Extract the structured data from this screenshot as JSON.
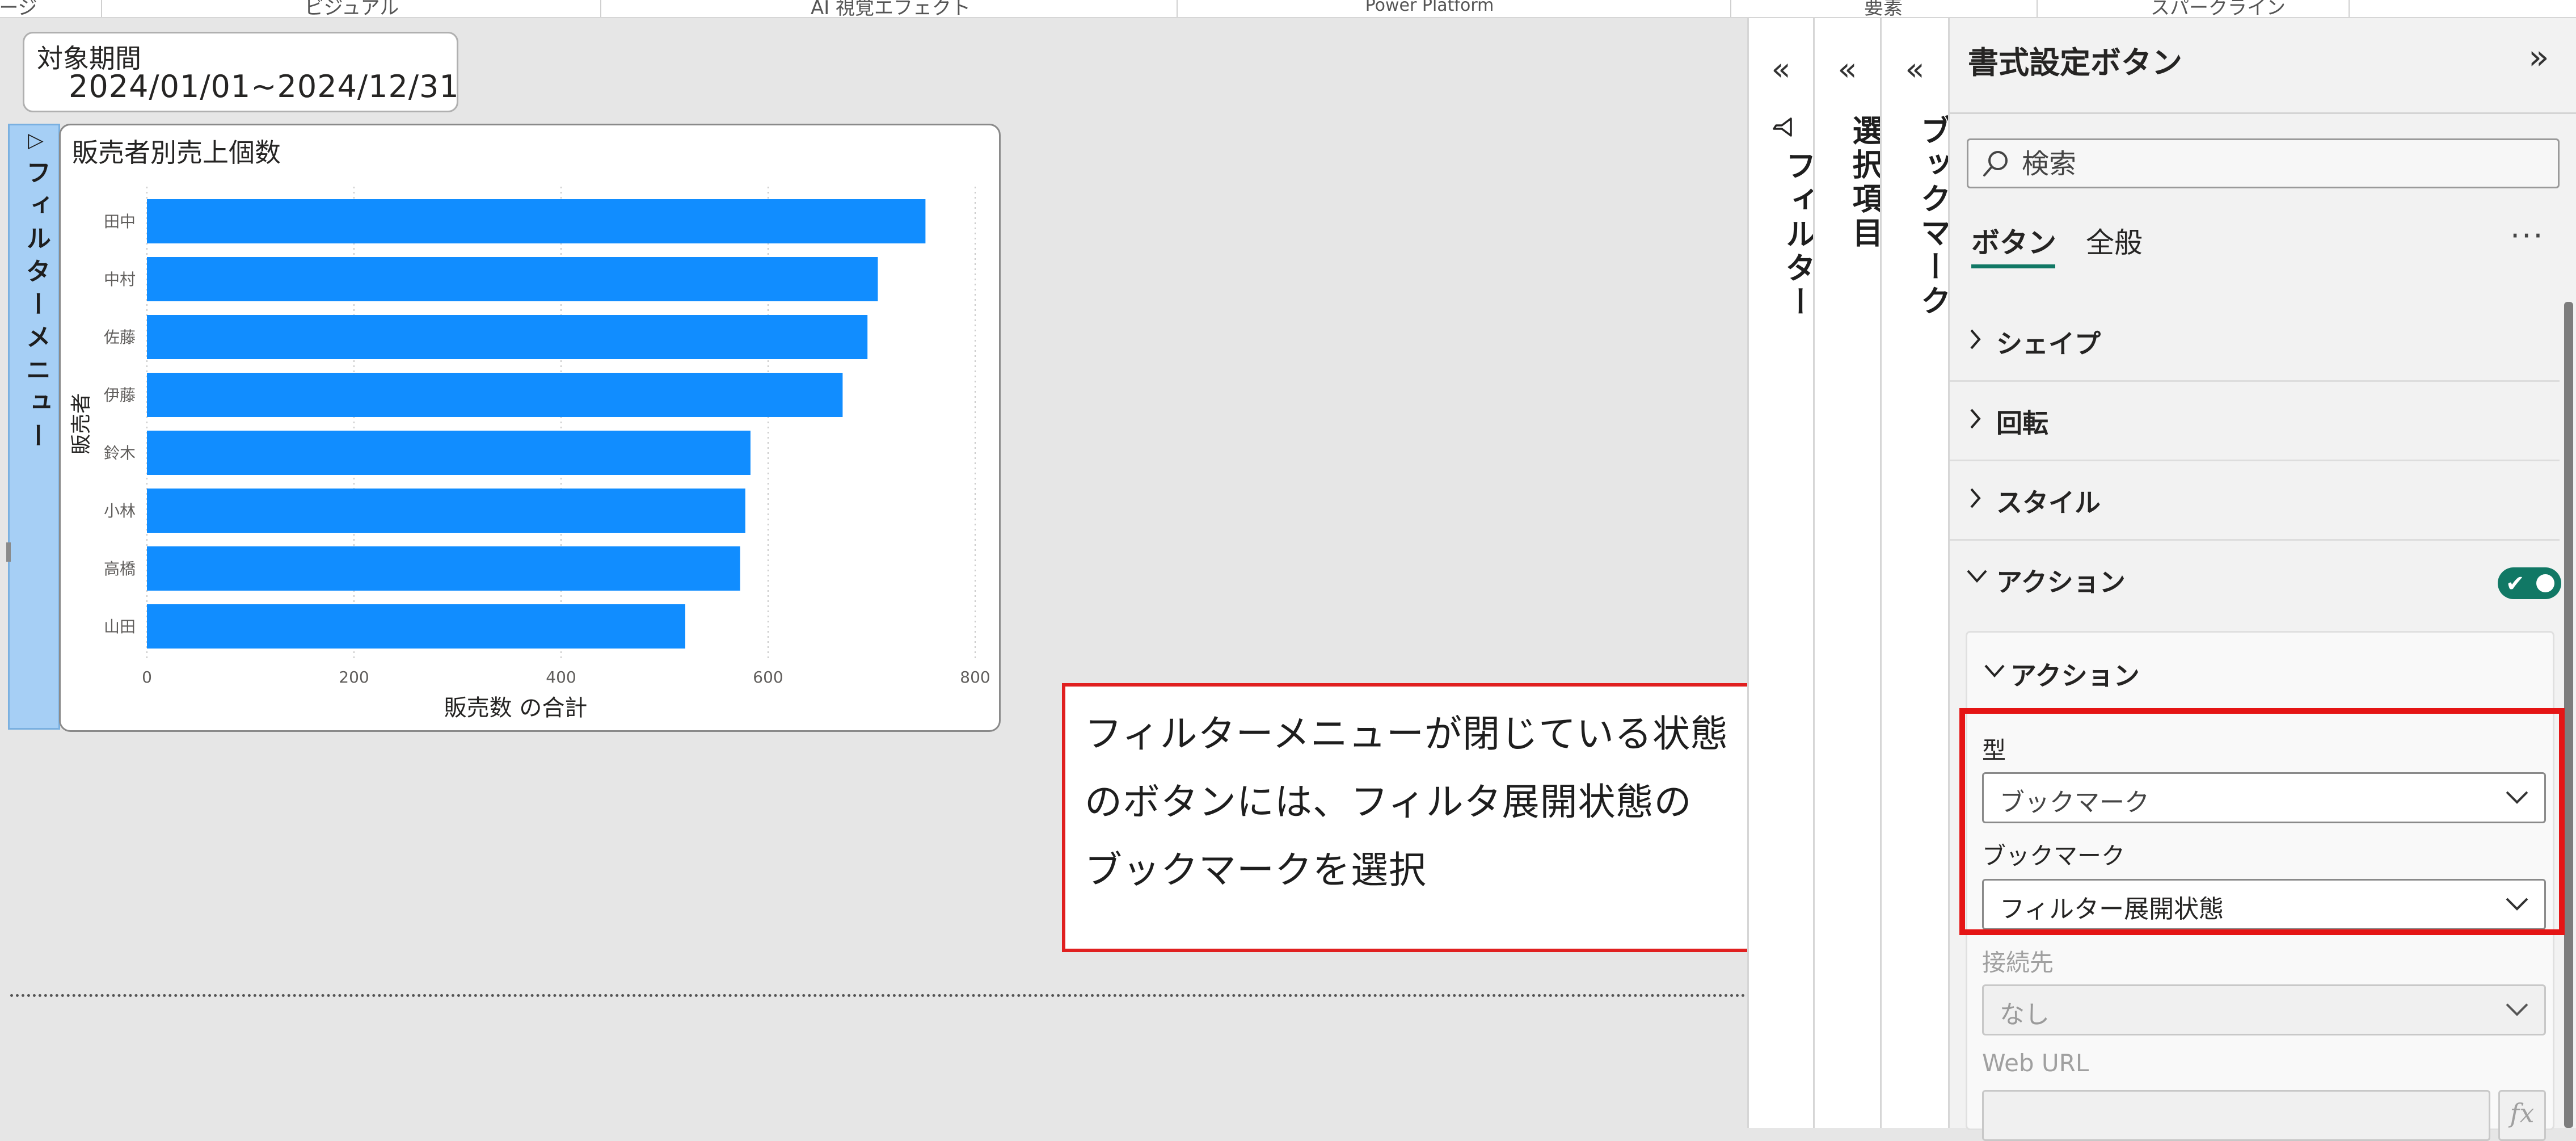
{
  "ribbon": {
    "tabs": [
      "ページ",
      "ビジュアル",
      "AI 視覚エフェクト",
      "Power Platform",
      "要素",
      "スパークライン"
    ]
  },
  "period_card": {
    "title": "対象期間",
    "value": "2024/01/01~2024/12/31",
    "more": "..."
  },
  "filter_menu_button": {
    "arrow": "▷",
    "label": "フィルターメニュー"
  },
  "chart_data": {
    "type": "bar",
    "orientation": "horizontal",
    "title": "販売者別売上個数",
    "xlabel": "販売数 の合計",
    "ylabel": "販売者",
    "categories": [
      "田中",
      "中村",
      "佐藤",
      "伊藤",
      "鈴木",
      "小林",
      "高橋",
      "山田"
    ],
    "values": [
      752,
      706,
      696,
      672,
      583,
      578,
      573,
      520
    ],
    "xlim": [
      0,
      800
    ],
    "xticks": [
      0,
      200,
      400,
      600,
      800
    ],
    "grid": "vertical-dotted",
    "bar_color": "#118dff"
  },
  "callout": {
    "lines": [
      "フィルターメニューが閉じている状態",
      "のボタンには、フィルタ展開状態の",
      "ブックマークを選択"
    ],
    "border_color": "#e02020"
  },
  "panes": {
    "filter": {
      "chevron": "«",
      "icon": "filter-icon",
      "label": "フィルター"
    },
    "selection": {
      "chevron": "«",
      "label": "選択項目"
    },
    "bookmark": {
      "chevron": "«",
      "label": "ブックマーク"
    }
  },
  "format_pane": {
    "title": "書式設定ボタン",
    "collapse": "»",
    "search_placeholder": "検索",
    "tabs": {
      "button": "ボタン",
      "general": "全般"
    },
    "more": "···",
    "sections": [
      "シェイプ",
      "回転",
      "スタイル",
      "アクション"
    ],
    "action_toggle": "on",
    "action_card": {
      "title": "アクション",
      "type_label": "型",
      "type_value": "ブックマーク",
      "bookmark_label": "ブックマーク",
      "bookmark_value": "フィルター展開状態",
      "destination_label": "接続先",
      "destination_value": "なし",
      "weburl_label": "Web URL",
      "fx": "fx"
    }
  },
  "colors": {
    "accent": "#117865",
    "highlight": "#e51515",
    "bar": "#118dff",
    "filter_button": "#a6cff5"
  }
}
